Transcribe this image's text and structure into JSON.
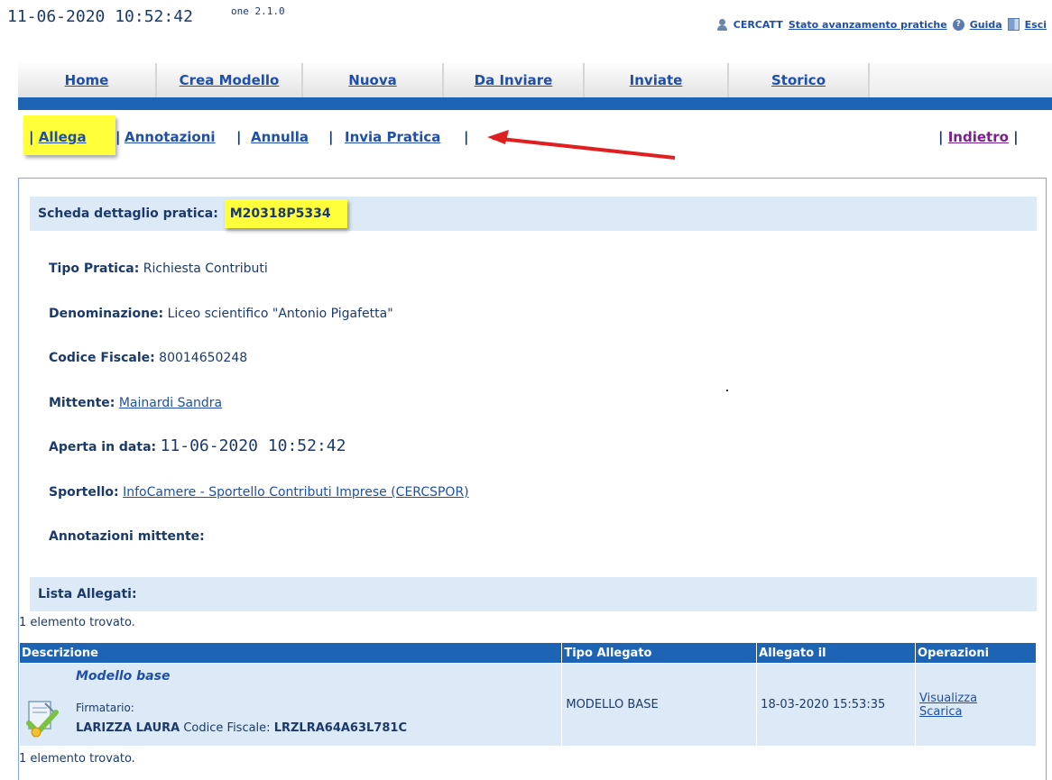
{
  "topbar": {
    "datetime": "11-06-2020 10:52:42",
    "version": "one 2.1.0",
    "user": "CERCATT",
    "status_link": "Stato avanzamento pratiche",
    "help": "Guida",
    "exit": "Esci"
  },
  "tabs": [
    "Home",
    "Crea Modello",
    "Nuova",
    "Da Inviare",
    "Inviate",
    "Storico"
  ],
  "actions": {
    "allega": "Allega",
    "annotazioni": "Annotazioni",
    "annulla": "Annulla",
    "invia": "Invia Pratica",
    "indietro": "Indietro",
    "sep": "|"
  },
  "detail": {
    "heading": "Scheda dettaglio pratica:",
    "code": "M20318P5334",
    "tipo_label": "Tipo Pratica:",
    "tipo_value": "Richiesta Contributi",
    "denom_label": "Denominazione:",
    "denom_value": "Liceo scientifico \"Antonio Pigafetta\"",
    "cf_label": "Codice Fiscale:",
    "cf_value": "80014650248",
    "mittente_label": "Mittente:",
    "mittente_value": "Mainardi Sandra",
    "aperta_label": "Aperta in data:",
    "aperta_value": "11-06-2020 10:52:42",
    "sportello_label": "Sportello:",
    "sportello_value": "InfoCamere - Sportello Contributi Imprese (CERCSPOR)",
    "annotazioni_label": "Annotazioni mittente:"
  },
  "attachments": {
    "heading": "Lista Allegati:",
    "found_top": "1 elemento trovato.",
    "found_bottom": "1 elemento trovato.",
    "columns": [
      "Descrizione",
      "Tipo Allegato",
      "Allegato il",
      "Operazioni"
    ],
    "rows": [
      {
        "title": "Modello base",
        "firmatario_label": "Firmatario:",
        "name": "LARIZZA LAURA",
        "cf_label": "Codice Fiscale:",
        "cf": "LRZLRA64A63L781C",
        "tipo": "MODELLO BASE",
        "date": "18-03-2020 15:53:35",
        "op_view": "Visualizza",
        "op_download": "Scarica"
      }
    ]
  }
}
